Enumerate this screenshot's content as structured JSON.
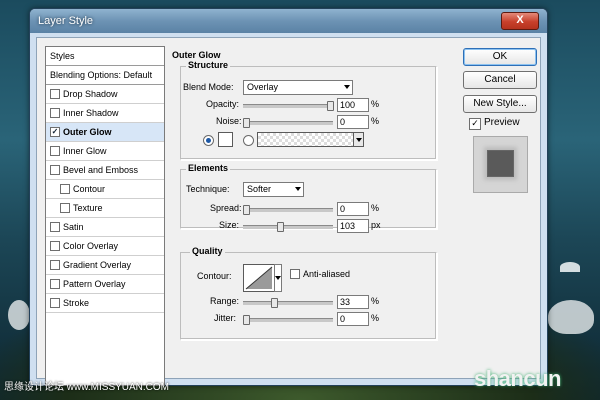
{
  "window": {
    "title": "Layer Style",
    "close_label": "X"
  },
  "left_panel": {
    "styles_header": "Styles",
    "blending_options": "Blending Options: Default",
    "items": [
      {
        "label": "Drop Shadow",
        "checked": false,
        "selected": false,
        "indent": false
      },
      {
        "label": "Inner Shadow",
        "checked": false,
        "selected": false,
        "indent": false
      },
      {
        "label": "Outer Glow",
        "checked": true,
        "selected": true,
        "indent": false
      },
      {
        "label": "Inner Glow",
        "checked": false,
        "selected": false,
        "indent": false
      },
      {
        "label": "Bevel and Emboss",
        "checked": false,
        "selected": false,
        "indent": false
      },
      {
        "label": "Contour",
        "checked": false,
        "selected": false,
        "indent": true
      },
      {
        "label": "Texture",
        "checked": false,
        "selected": false,
        "indent": true
      },
      {
        "label": "Satin",
        "checked": false,
        "selected": false,
        "indent": false
      },
      {
        "label": "Color Overlay",
        "checked": false,
        "selected": false,
        "indent": false
      },
      {
        "label": "Gradient Overlay",
        "checked": false,
        "selected": false,
        "indent": false
      },
      {
        "label": "Pattern Overlay",
        "checked": false,
        "selected": false,
        "indent": false
      },
      {
        "label": "Stroke",
        "checked": false,
        "selected": false,
        "indent": false
      }
    ]
  },
  "panel": {
    "title": "Outer Glow",
    "structure": {
      "title": "Structure",
      "blend_mode_label": "Blend Mode:",
      "blend_mode_value": "Overlay",
      "opacity_label": "Opacity:",
      "opacity_value": "100",
      "opacity_unit": "%",
      "opacity_level": 1.0,
      "noise_label": "Noise:",
      "noise_value": "0",
      "noise_unit": "%",
      "noise_level": 0.0,
      "color_swatch": "#ffffff",
      "color_mode": "solid"
    },
    "elements": {
      "title": "Elements",
      "technique_label": "Technique:",
      "technique_value": "Softer",
      "spread_label": "Spread:",
      "spread_value": "0",
      "spread_unit": "%",
      "spread_level": 0.0,
      "size_label": "Size:",
      "size_value": "103",
      "size_unit": "px",
      "size_level": 0.41
    },
    "quality": {
      "title": "Quality",
      "contour_label": "Contour:",
      "anti_aliased_label": "Anti-aliased",
      "anti_aliased_checked": false,
      "range_label": "Range:",
      "range_value": "33",
      "range_unit": "%",
      "range_level": 0.33,
      "jitter_label": "Jitter:",
      "jitter_value": "0",
      "jitter_unit": "%",
      "jitter_level": 0.0
    }
  },
  "buttons": {
    "ok": "OK",
    "cancel": "Cancel",
    "new_style": "New Style...",
    "preview_label": "Preview",
    "preview_checked": true
  },
  "watermarks": {
    "left": "思缘设计论坛 www.MISSYUAN.COM",
    "right": "shancun"
  }
}
